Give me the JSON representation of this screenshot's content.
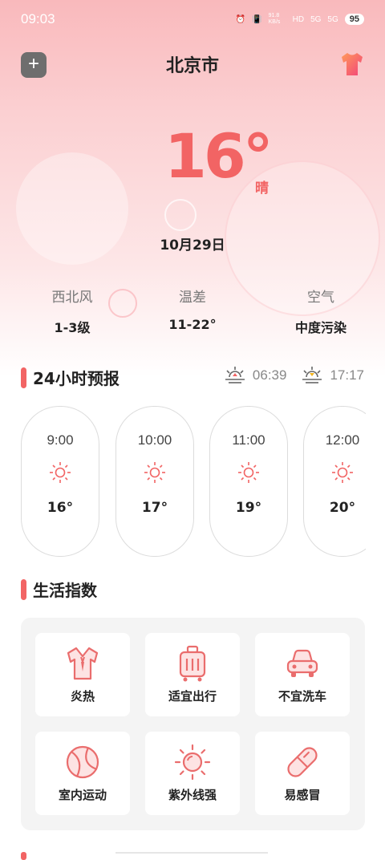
{
  "status": {
    "time": "09:03",
    "speed": "91.8 KB/s",
    "hd": "HD",
    "net1": "5G",
    "net2": "5G",
    "battery": "95"
  },
  "header": {
    "city": "北京市",
    "add_label": "+"
  },
  "current": {
    "temperature": "16°",
    "condition": "晴",
    "date": "10月29日"
  },
  "stats": [
    {
      "label": "西北风",
      "value": "1-3级"
    },
    {
      "label": "温差",
      "value": "11-22°"
    },
    {
      "label": "空气",
      "value": "中度污染"
    }
  ],
  "forecast_section": {
    "title": "24小时预报",
    "sunrise": "06:39",
    "sunset": "17:17"
  },
  "hourly": [
    {
      "time": "9:00",
      "temp": "16°",
      "icon": "sun-icon"
    },
    {
      "time": "10:00",
      "temp": "17°",
      "icon": "sun-icon"
    },
    {
      "time": "11:00",
      "temp": "19°",
      "icon": "sun-icon"
    },
    {
      "time": "12:00",
      "temp": "20°",
      "icon": "sun-icon"
    }
  ],
  "life_section": {
    "title": "生活指数",
    "items": [
      {
        "label": "炎热",
        "icon": "shirt-icon"
      },
      {
        "label": "适宜出行",
        "icon": "luggage-icon"
      },
      {
        "label": "不宜洗车",
        "icon": "car-icon"
      },
      {
        "label": "室内运动",
        "icon": "ball-icon"
      },
      {
        "label": "紫外线强",
        "icon": "uv-icon"
      },
      {
        "label": "易感冒",
        "icon": "pill-icon"
      }
    ]
  },
  "colors": {
    "accent": "#f26464",
    "background_top": "#f9b9bc"
  }
}
